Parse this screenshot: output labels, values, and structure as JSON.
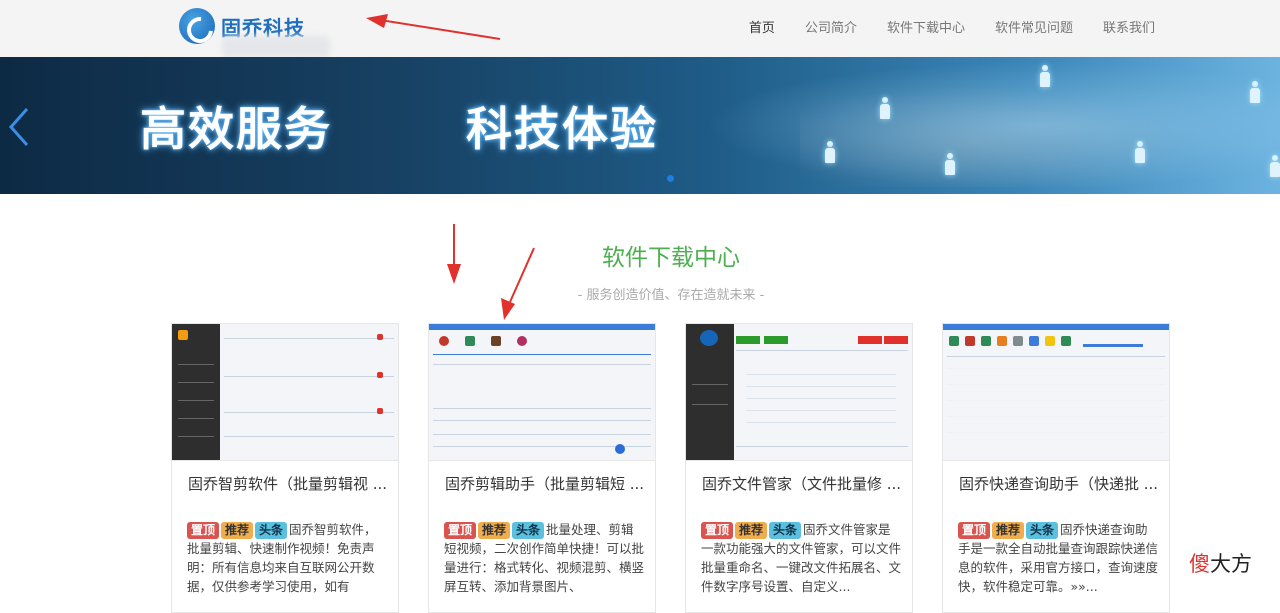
{
  "header": {
    "logo_text": "固乔科技",
    "nav": [
      {
        "label": "首页",
        "active": true
      },
      {
        "label": "公司简介"
      },
      {
        "label": "软件下载中心"
      },
      {
        "label": "软件常见问题"
      },
      {
        "label": "联系我们"
      }
    ]
  },
  "banner": {
    "title_left": "高效服务",
    "title_right": "科技体验"
  },
  "section": {
    "title": "软件下载中心",
    "subtitle": "- 服务创造价值、存在造就未来 -"
  },
  "tags": {
    "top": "置顶",
    "rec": "推荐",
    "news": "头条"
  },
  "cards": [
    {
      "title": "固乔智剪软件（批量剪辑视 ...",
      "desc": "固乔智剪软件，批量剪辑、快速制作视频！免责声明：所有信息均来自互联网公开数据，仅供参考学习使用，如有"
    },
    {
      "title": "固乔剪辑助手（批量剪辑短 ...",
      "desc": "批量处理、剪辑短视频，二次创作简单快捷！可以批量进行：格式转化、视频混剪、横竖屏互转、添加背景图片、"
    },
    {
      "title": "固乔文件管家（文件批量修 ...",
      "desc": "固乔文件管家是一款功能强大的文件管家，可以文件批量重命名、一键改文件拓展名、文件数字序号设置、自定义..."
    },
    {
      "title": "固乔快递查询助手（快递批 ...",
      "desc": "固乔快递查询助手是一款全自动批量查询跟踪快递信息的软件，采用官方接口，查询速度快，软件稳定可靠。»»..."
    }
  ],
  "watermark": {
    "part1": "傻",
    "part2": "大方"
  },
  "colors": {
    "accent_green": "#4caf50",
    "brand_blue": "#1e6fc0",
    "annotation_red": "#e0312d"
  }
}
